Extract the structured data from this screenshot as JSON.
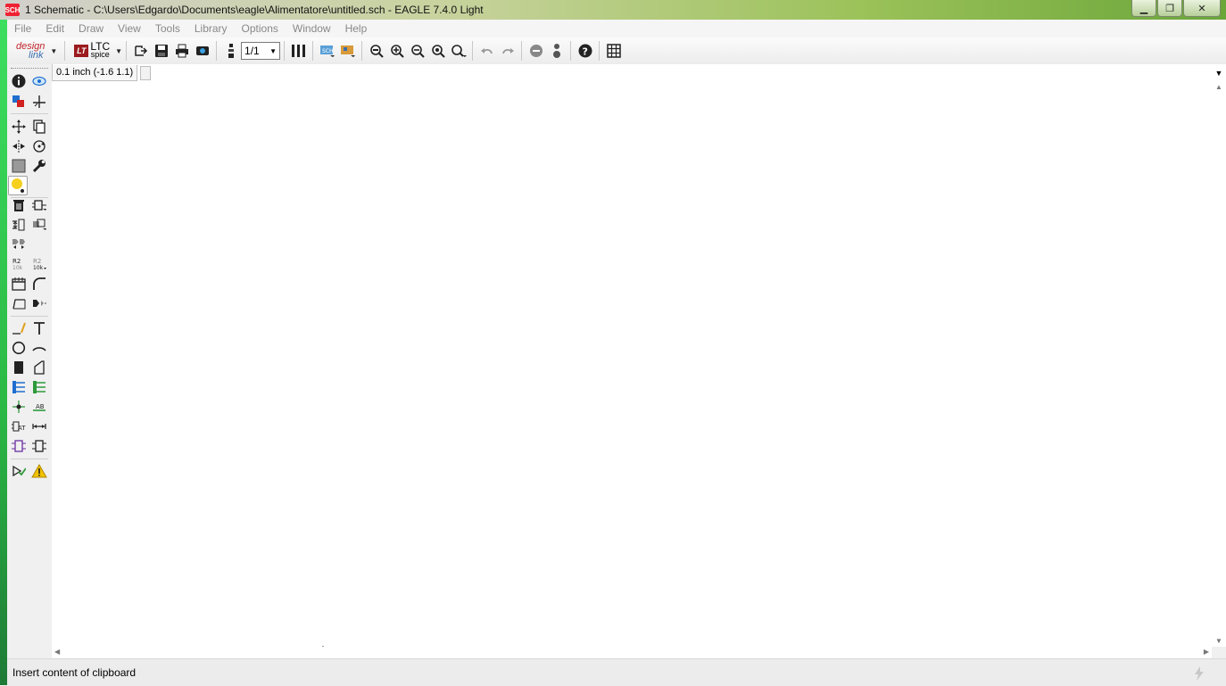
{
  "window": {
    "title": "1 Schematic - C:\\Users\\Edgardo\\Documents\\eagle\\Alimentatore\\untitled.sch - EAGLE 7.4.0 Light",
    "app_icon": "SCH",
    "min_label": "▁",
    "max_label": "❐",
    "close_label": "✕"
  },
  "menu": {
    "items": [
      "File",
      "Edit",
      "Draw",
      "View",
      "Tools",
      "Library",
      "Options",
      "Window",
      "Help"
    ]
  },
  "toolbar": {
    "designlink_a": "design",
    "designlink_b": "link",
    "ltc_a": "LTC",
    "ltc_b": "spice",
    "ltc_mark": "LT",
    "sheet_value": "1/1",
    "icons": [
      "open-icon",
      "save-icon",
      "print-icon",
      "cam-icon",
      "script-icon",
      "sheet-select",
      "board-icon",
      "sch-icon",
      "brd-icon",
      "zoom-fit-icon",
      "zoom-in-icon",
      "zoom-out-icon",
      "zoom-redraw-icon",
      "zoom-select-icon",
      "undo-icon",
      "redo-icon",
      "stop-icon",
      "go-icon",
      "help-icon",
      "grid-icon"
    ]
  },
  "command": {
    "grid_info": "0.1 inch (-1.6 1.1)",
    "input_value": ""
  },
  "status": {
    "text": "Insert content of clipboard"
  },
  "colors": {
    "canvas": "#ffffff",
    "desktop_green": "#2bb845",
    "active_tool": "#f5d01e",
    "warning": "#f2c200",
    "blue_icon": "#1f6fd0",
    "green_icon": "#2e9a3a"
  }
}
